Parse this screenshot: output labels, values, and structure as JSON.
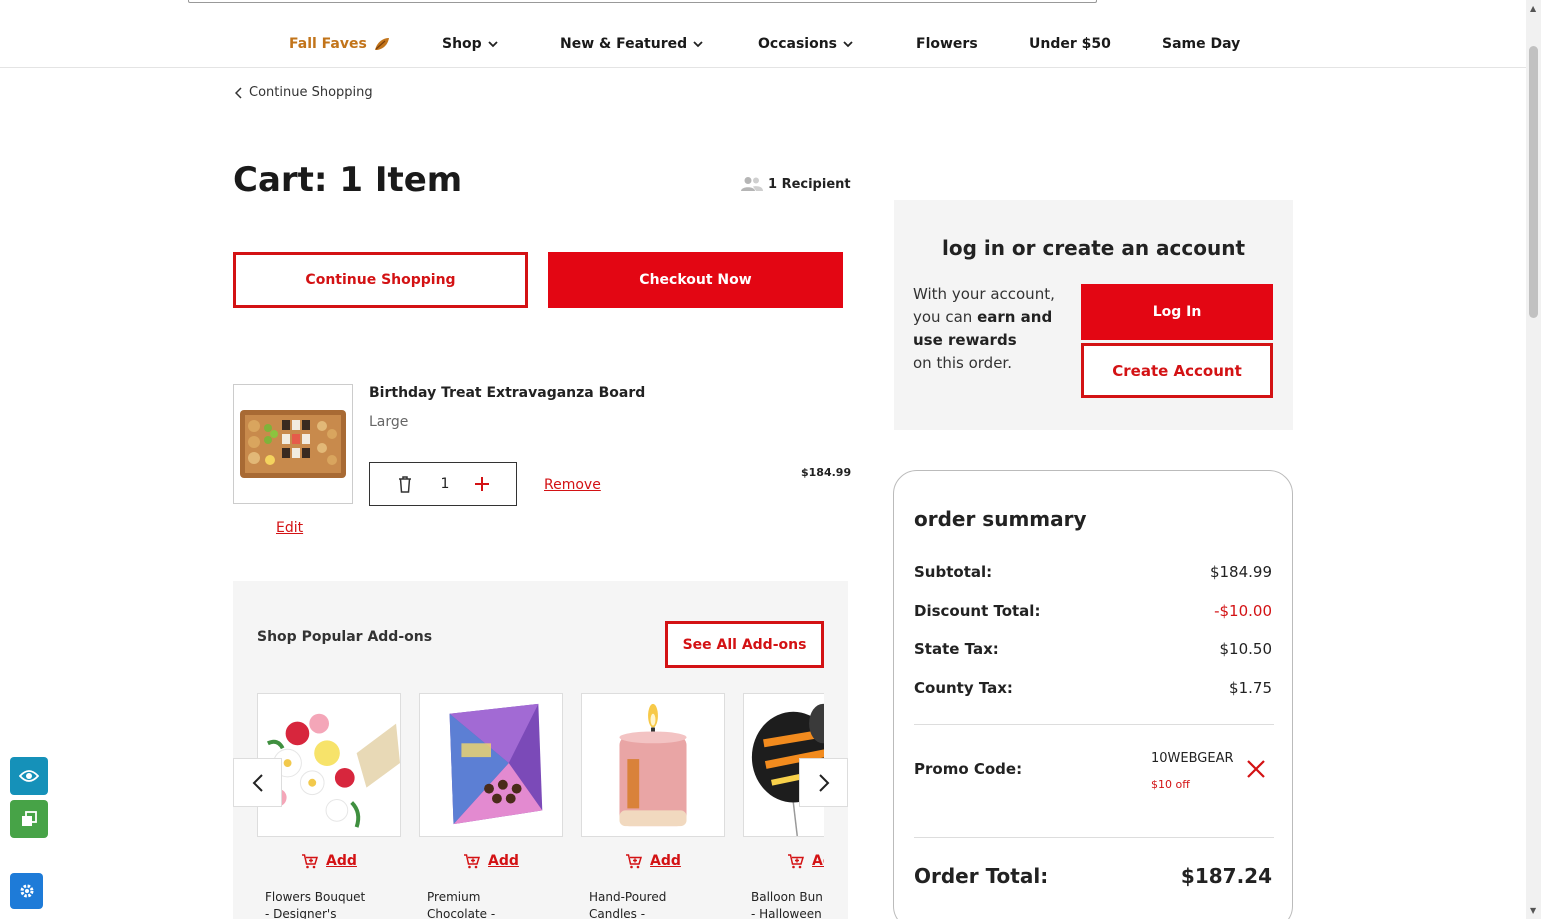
{
  "nav": {
    "items": [
      {
        "label": "Fall Faves",
        "icon": "leaf-icon"
      },
      {
        "label": "Shop",
        "icon": "chevron-down-icon"
      },
      {
        "label": "New & Featured",
        "icon": "chevron-down-icon"
      },
      {
        "label": "Occasions",
        "icon": "chevron-down-icon"
      },
      {
        "label": "Flowers"
      },
      {
        "label": "Under $50"
      },
      {
        "label": "Same Day"
      }
    ]
  },
  "back_link": "Continue Shopping",
  "cart": {
    "title": "Cart: 1 Item",
    "recipients": "1 Recipient",
    "continue_label": "Continue Shopping",
    "checkout_label": "Checkout Now"
  },
  "item": {
    "name": "Birthday Treat Extravaganza Board",
    "size": "Large",
    "quantity": "1",
    "remove_label": "Remove",
    "edit_label": "Edit",
    "price": "$184.99"
  },
  "addons": {
    "title": "Shop Popular Add-ons",
    "see_all_label": "See All Add-ons",
    "add_label": "Add",
    "cards": [
      {
        "name_line1": "Flowers Bouquet",
        "name_line2": "- Designer's"
      },
      {
        "name_line1": "Premium",
        "name_line2": "Chocolate -"
      },
      {
        "name_line1": "Hand-Poured",
        "name_line2": "Candles -"
      },
      {
        "name_line1": "Balloon Bun",
        "name_line2": "- Halloween"
      }
    ]
  },
  "account": {
    "title": "log in or create an account",
    "text_1": "With your account, you can",
    "text_bold": "earn and use rewards",
    "text_2": "on this order.",
    "login_label": "Log In",
    "create_label": "Create Account"
  },
  "summary": {
    "title": "order summary",
    "subtotal_label": "Subtotal:",
    "subtotal": "$184.99",
    "discount_label": "Discount Total:",
    "discount": "-$10.00",
    "state_tax_label": "State Tax:",
    "state_tax": "$10.50",
    "county_tax_label": "County Tax:",
    "county_tax": "$1.75",
    "promo_label": "Promo Code:",
    "promo_code": "10WEBGEAR",
    "promo_off": "$10 off",
    "total_label": "Order Total:",
    "total": "$187.24"
  },
  "colors": {
    "brand_red": "#e30613",
    "fall_orange": "#c2741a"
  }
}
